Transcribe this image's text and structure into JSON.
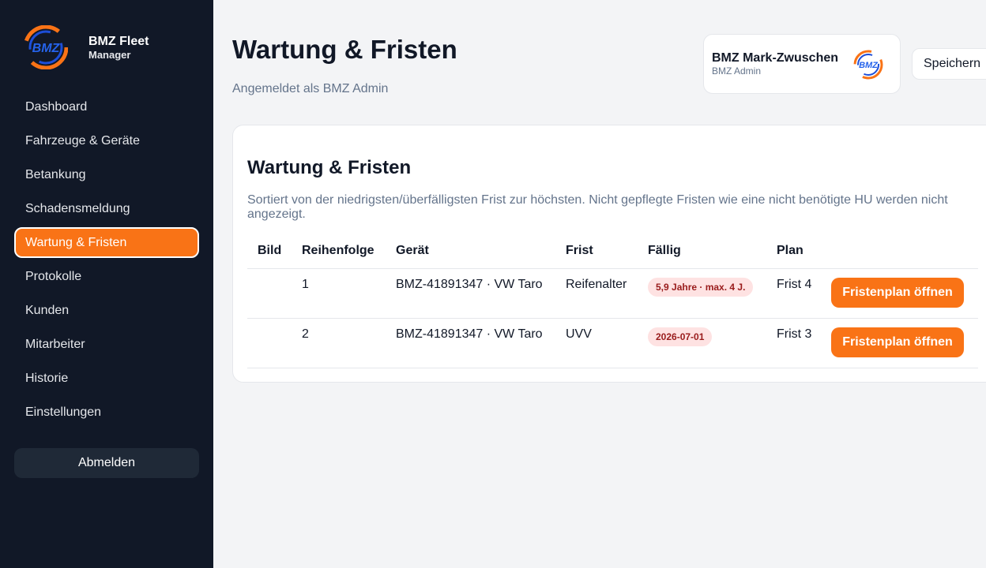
{
  "brand": {
    "title": "BMZ Fleet",
    "subtitle": "Manager",
    "logo_text": "BMZ"
  },
  "sidebar": {
    "items": [
      {
        "label": "Dashboard"
      },
      {
        "label": "Fahrzeuge & Geräte"
      },
      {
        "label": "Betankung"
      },
      {
        "label": "Schadensmeldung"
      },
      {
        "label": "Wartung & Fristen",
        "active": true
      },
      {
        "label": "Protokolle"
      },
      {
        "label": "Kunden"
      },
      {
        "label": "Mitarbeiter"
      },
      {
        "label": "Historie"
      },
      {
        "label": "Einstellungen"
      }
    ],
    "logout_label": "Abmelden"
  },
  "header": {
    "title": "Wartung & Fristen",
    "subtitle": "Angemeldet als BMZ Admin",
    "user_name": "BMZ Mark-Zwuschen",
    "user_role": "BMZ Admin",
    "save_label": "Speichern"
  },
  "card": {
    "title": "Wartung & Fristen",
    "description": "Sortiert von der niedrigsten/überfälligsten Frist zur höchsten. Nicht gepflegte Fristen wie eine nicht benötigte HU werden nicht angezeigt.",
    "columns": [
      "Bild",
      "Reihenfolge",
      "Gerät",
      "Frist",
      "Fällig",
      "Plan"
    ],
    "rows": [
      {
        "order": "1",
        "device": "BMZ-41891347 · VW Taro",
        "deadline": "Reifenalter",
        "due": "5,9 Jahre · max. 4 J.",
        "plan": "Frist 4",
        "action": "Fristenplan öffnen"
      },
      {
        "order": "2",
        "device": "BMZ-41891347 · VW Taro",
        "deadline": "UVV",
        "due": "2026-07-01",
        "plan": "Frist 3",
        "action": "Fristenplan öffnen"
      }
    ]
  },
  "colors": {
    "sidebar_bg": "#111827",
    "accent": "#f97316",
    "badge_bg": "#fee2e2",
    "badge_text": "#991b1b"
  }
}
